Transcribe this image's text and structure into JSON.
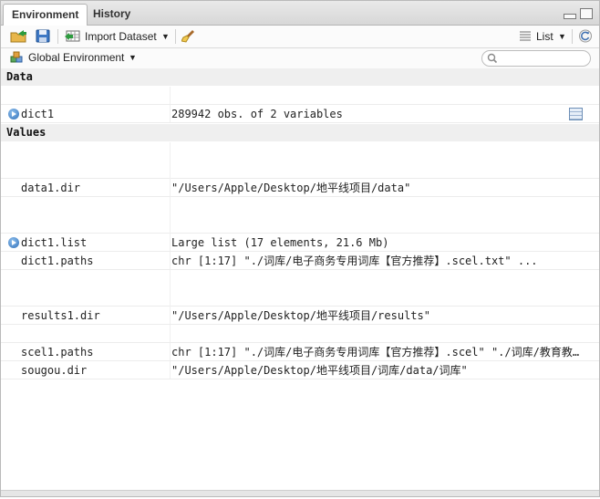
{
  "tabs": [
    {
      "label": "Environment",
      "active": true
    },
    {
      "label": "History",
      "active": false
    }
  ],
  "toolbar": {
    "import_label": "Import Dataset",
    "view_label": "List"
  },
  "env": {
    "scope_label": "Global Environment",
    "search_placeholder": ""
  },
  "sections": {
    "data": "Data",
    "values": "Values"
  },
  "data_rows": [
    {
      "name": "dict1",
      "value": "289942 obs. of 2 variables",
      "expandable": true,
      "view": true
    }
  ],
  "value_rows": [
    {
      "name": "",
      "value": ""
    },
    {
      "name": "data1.dir",
      "value": "\"/Users/Apple/Desktop/地平线项目/data\""
    },
    {
      "name": "",
      "value": ""
    },
    {
      "name": "dict1.list",
      "value": "Large list (17 elements, 21.6 Mb)",
      "expandable": true
    },
    {
      "name": "dict1.paths",
      "value": "chr [1:17] \"./词库/电子商务专用词库【官方推荐】.scel.txt\" ..."
    },
    {
      "name": "",
      "value": ""
    },
    {
      "name": "results1.dir",
      "value": "\"/Users/Apple/Desktop/地平线项目/results\""
    },
    {
      "name": "",
      "value": ""
    },
    {
      "name": "scel1.paths",
      "value": "chr [1:17] \"./词库/电子商务专用词库【官方推荐】.scel\" \"./词库/教育教…"
    },
    {
      "name": "sougou.dir",
      "value": "\"/Users/Apple/Desktop/地平线项目/词库/data/词库\""
    }
  ],
  "colors": {
    "accent": "#2f6fb8",
    "section_bg": "#efefef",
    "toolbar_bg": "#fbfbfb"
  }
}
